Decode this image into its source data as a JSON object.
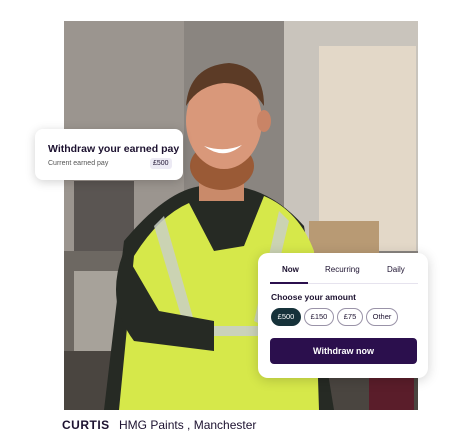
{
  "photo": {
    "description_icon": "worker-photo"
  },
  "earned_card": {
    "title": "Withdraw your earned pay",
    "label": "Current earned pay",
    "amount": "£500"
  },
  "withdraw_card": {
    "tabs": [
      {
        "label": "Now",
        "active": true
      },
      {
        "label": "Recurring",
        "active": false
      },
      {
        "label": "Daily",
        "active": false
      }
    ],
    "choose_label": "Choose your amount",
    "amounts": [
      {
        "label": "£500",
        "selected": true
      },
      {
        "label": "£150",
        "selected": false
      },
      {
        "label": "£75",
        "selected": false
      },
      {
        "label": "Other",
        "selected": false
      }
    ],
    "button_label": "Withdraw now"
  },
  "caption": {
    "brand": "CURTIS",
    "text": "HMG Paints , Manchester"
  },
  "colors": {
    "primary": "#2b0f4d",
    "chip_selected": "#16323a",
    "vest": "#d6e84a"
  }
}
